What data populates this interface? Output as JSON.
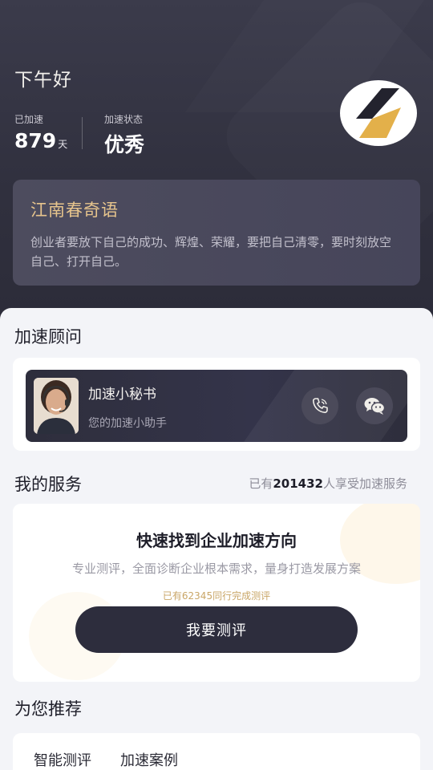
{
  "header": {
    "greeting": "下午好",
    "accelerated_label": "已加速",
    "accelerated_value": "879",
    "accelerated_unit": "天",
    "status_label": "加速状态",
    "status_value": "优秀",
    "logo_icon": "lightning-icon"
  },
  "quote": {
    "title": "江南春奇语",
    "text": "创业者要放下自己的成功、辉煌、荣耀，要把自己清零，要时刻放空自己、打开自己。"
  },
  "advisor": {
    "section_title": "加速顾问",
    "name": "加速小秘书",
    "subtitle": "您的加速小助手",
    "avatar_icon": "avatar-photo",
    "phone_icon": "phone-icon",
    "wechat_icon": "wechat-icon"
  },
  "services": {
    "section_title": "我的服务",
    "count_prefix": "已有",
    "count_value": "201432",
    "count_suffix": "人享受加速服务",
    "card_title": "快速找到企业加速方向",
    "card_desc": "专业测评，全面诊断企业根本需求，量身打造发展方案",
    "card_note": "已有62345同行完成测评",
    "button_label": "我要测评"
  },
  "recommend": {
    "section_title": "为您推荐",
    "tabs": [
      "智能测评",
      "加速案例"
    ]
  },
  "colors": {
    "header_bg": "#343443",
    "accent_gold": "#e7c58d",
    "dark_button": "#2d2d3d"
  }
}
